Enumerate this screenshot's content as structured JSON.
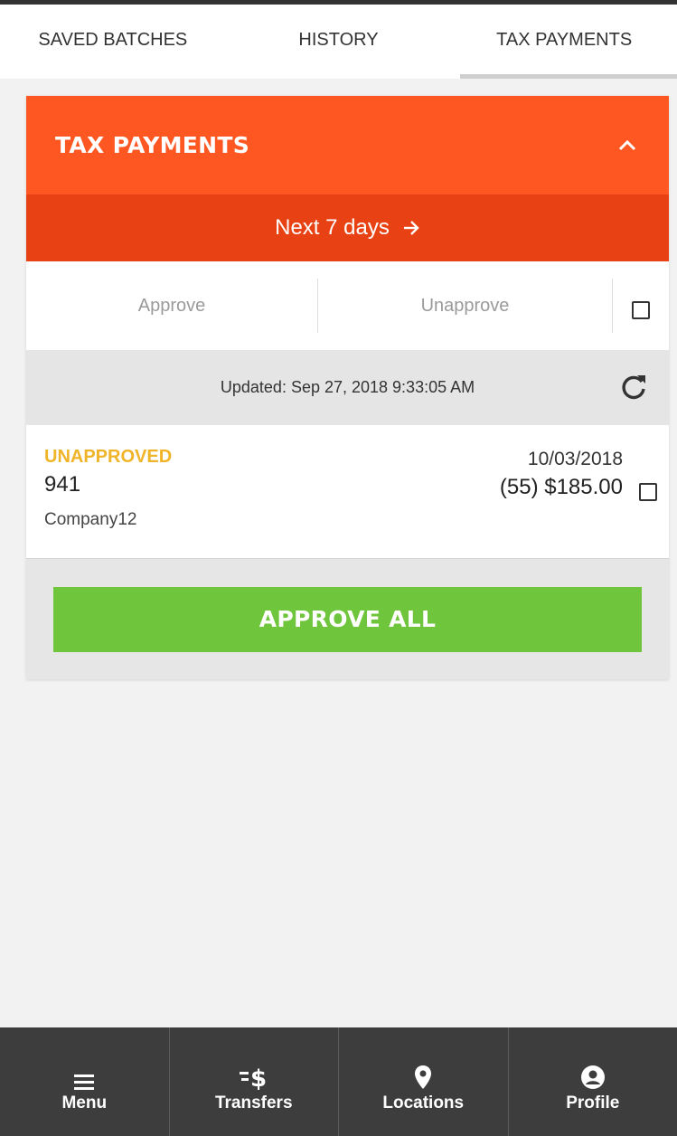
{
  "tabs": [
    {
      "label": "SAVED BATCHES",
      "active": false
    },
    {
      "label": "HISTORY",
      "active": false
    },
    {
      "label": "TAX PAYMENTS",
      "active": true
    }
  ],
  "card": {
    "title": "TAX PAYMENTS",
    "next_label": "Next 7 days",
    "approve_label": "Approve",
    "unapprove_label": "Unapprove",
    "updated_text": "Updated: Sep 27, 2018 9:33:05 AM",
    "items": [
      {
        "status": "UNAPPROVED",
        "code": "941",
        "company": "Company12",
        "date": "10/03/2018",
        "amount": "(55) $185.00"
      }
    ],
    "approve_all_label": "APPROVE ALL"
  },
  "bottom_nav": [
    {
      "label": "Menu",
      "icon": "hamburger-icon"
    },
    {
      "label": "Transfers",
      "icon": "transfers-icon"
    },
    {
      "label": "Locations",
      "icon": "map-pin-icon"
    },
    {
      "label": "Profile",
      "icon": "user-circle-icon"
    }
  ],
  "colors": {
    "header_orange": "#ff5722",
    "next_red": "#e84114",
    "status_yellow": "#f0b429",
    "approve_green": "#6fc53c",
    "nav_dark": "#3d3d3d"
  }
}
